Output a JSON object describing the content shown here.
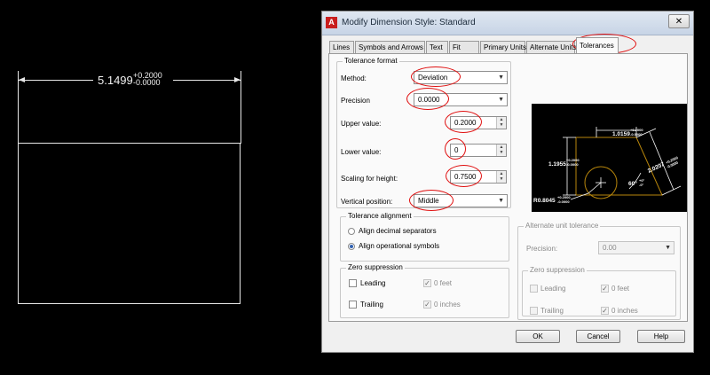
{
  "canvas": {
    "dimension_value": "5.1499",
    "tol_upper": "+0.2000",
    "tol_lower": "-0.0000"
  },
  "dialog": {
    "title": "Modify Dimension Style: Standard",
    "app_icon_letter": "A",
    "close_glyph": "✕",
    "tabs": [
      {
        "label": "Lines"
      },
      {
        "label": "Symbols and Arrows"
      },
      {
        "label": "Text"
      },
      {
        "label": "Fit"
      },
      {
        "label": "Primary Units"
      },
      {
        "label": "Alternate Units"
      },
      {
        "label": "Tolerances"
      }
    ],
    "tolerance_format": {
      "group_label": "Tolerance format",
      "method_label": "Method:",
      "method_value": "Deviation",
      "precision_label": "Precision",
      "precision_value": "0.0000",
      "upper_label": "Upper value:",
      "upper_value": "0.2000",
      "lower_label": "Lower value:",
      "lower_value": "0",
      "scaling_label": "Scaling for height:",
      "scaling_value": "0.7500",
      "vpos_label": "Vertical position:",
      "vpos_value": "Middle"
    },
    "tolerance_alignment": {
      "group_label": "Tolerance alignment",
      "option1": "Align decimal separators",
      "option2": "Align operational symbols"
    },
    "zero_suppression": {
      "group_label": "Zero suppression",
      "leading": "Leading",
      "trailing": "Trailing",
      "feet": "0 feet",
      "inches": "0 inches"
    },
    "alt_unit_tolerance": {
      "group_label": "Alternate unit tolerance",
      "precision_label": "Precision:",
      "precision_value": "0.00",
      "zs_group_label": "Zero suppression",
      "leading": "Leading",
      "trailing": "Trailing",
      "feet": "0 feet",
      "inches": "0 inches"
    },
    "preview": {
      "dim_top": "1.0159",
      "dim_top_tol_up": "+0.2000",
      "dim_top_tol_lo": "-0.0000",
      "dim_left": "1.1955",
      "dim_left_tol_up": "+0.2000",
      "dim_left_tol_lo": "-0.0000",
      "dim_right": "2.0207",
      "dim_right_tol_up": "+0.2000",
      "dim_right_tol_lo": "-0.0000",
      "angle": "60°",
      "angle_tol_up": "+0°",
      "angle_tol_lo": "-0°",
      "radius": "R0.8045",
      "radius_tol_up": "+0.2000",
      "radius_tol_lo": "-0.0000"
    },
    "buttons": {
      "ok": "OK",
      "cancel": "Cancel",
      "help": "Help"
    }
  },
  "colors": {
    "annotation": "#e01010",
    "preview_geometry": "#b8860b",
    "selected_radio": "#3060b0"
  }
}
